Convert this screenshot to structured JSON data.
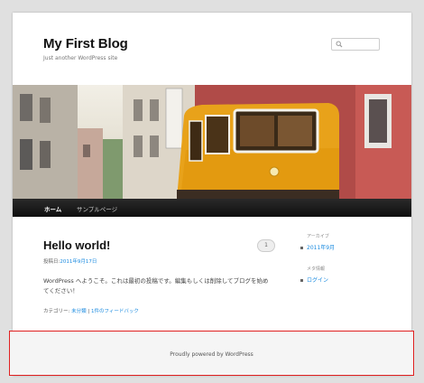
{
  "site": {
    "title": "My First Blog",
    "description": "Just another WordPress site"
  },
  "search": {
    "icon": "search-icon"
  },
  "nav": {
    "items": [
      "ホーム",
      "サンプルページ"
    ]
  },
  "post": {
    "title": "Hello world!",
    "comments": "1",
    "meta_label": "投稿日:",
    "date": "2011年9月17日",
    "content": "WordPress へようこそ。これは最初の投稿です。編集もしくは削除してブログを始めてください！",
    "cat_label": "カテゴリー:",
    "category": "未分類",
    "separator": " | ",
    "feedback": "1件のフィードバック"
  },
  "widgets": {
    "archives": {
      "title": "アーカイブ",
      "item": "2011年9月"
    },
    "meta": {
      "title": "メタ情報",
      "item": "ログイン"
    }
  },
  "footer": {
    "text": "Proudly powered by WordPress"
  },
  "colors": {
    "link": "#1b8be0",
    "nav_bg": "#222222",
    "highlight_border": "#e02020"
  }
}
